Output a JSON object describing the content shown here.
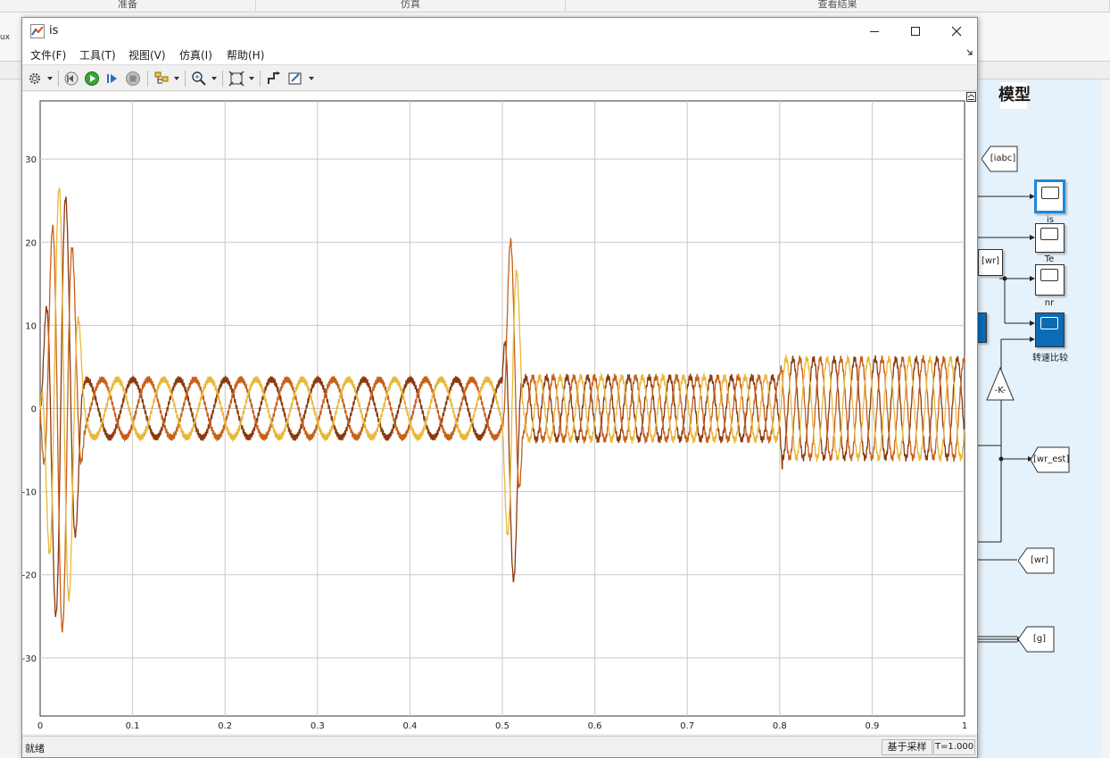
{
  "background": {
    "tabs": [
      "准备",
      "仿真",
      "查看结果"
    ],
    "toolstrip_fragment": "ux",
    "model_title": "模型",
    "blocks": {
      "goto_iabc": "[iabc]",
      "scope_is": "is",
      "scope_te": "Te",
      "from_wr": "[wr]",
      "scope_nr": "nr",
      "scope_speed_compare": "转速比较",
      "gain": "-K-",
      "goto_wr_est": "[wr_est]",
      "goto_wr": "[wr]",
      "goto_g": "[g]"
    }
  },
  "window": {
    "title": "is",
    "menu": [
      "文件(F)",
      "工具(T)",
      "视图(V)",
      "仿真(I)",
      "帮助(H)"
    ]
  },
  "toolbar": {
    "icons": [
      "gear-icon",
      "step-back-icon",
      "run-icon",
      "step-forward-icon",
      "stop-icon",
      "highlight-icon",
      "zoom-icon",
      "fit-to-view-icon",
      "cursor-measure-icon",
      "style-icon"
    ]
  },
  "status": {
    "text": "就绪",
    "mode": "基于采样",
    "time": "T=1.000"
  },
  "chart_data": {
    "type": "line",
    "title": "",
    "xlabel": "",
    "ylabel": "",
    "xlim": [
      0,
      1
    ],
    "ylim": [
      -37,
      37
    ],
    "x_ticks": [
      0,
      0.1,
      0.2,
      0.3,
      0.4,
      0.5,
      0.6,
      0.7,
      0.8,
      0.9,
      1
    ],
    "y_ticks": [
      30,
      20,
      10,
      0,
      -10,
      -20,
      -30
    ],
    "grid": true,
    "legend": "none",
    "series_colors": [
      "#8b3a0e",
      "#c8601a",
      "#e8b83a"
    ],
    "phase_offsets_deg": [
      0,
      -120,
      120
    ],
    "base_frequency_hz": 50,
    "segments": [
      {
        "t_start": 0.0,
        "t_end": 0.05,
        "description_amplitude_peak": 30
      },
      {
        "t_start": 0.05,
        "t_end": 0.5,
        "amplitude": 3.5,
        "frequency_hz": 20
      },
      {
        "t_start": 0.5,
        "t_end": 0.53,
        "peak": 21
      },
      {
        "t_start": 0.53,
        "t_end": 0.8,
        "amplitude": 3.8,
        "frequency_hz": 45
      },
      {
        "t_start": 0.8,
        "t_end": 1.0,
        "amplitude": 6.0,
        "frequency_hz": 45
      }
    ]
  },
  "colors": {
    "canvas_bg": "#e5f1fb",
    "scope_selected": "#1e88d7",
    "scope_filled": "#0b6bb5",
    "grid": "#c8c8c8"
  }
}
